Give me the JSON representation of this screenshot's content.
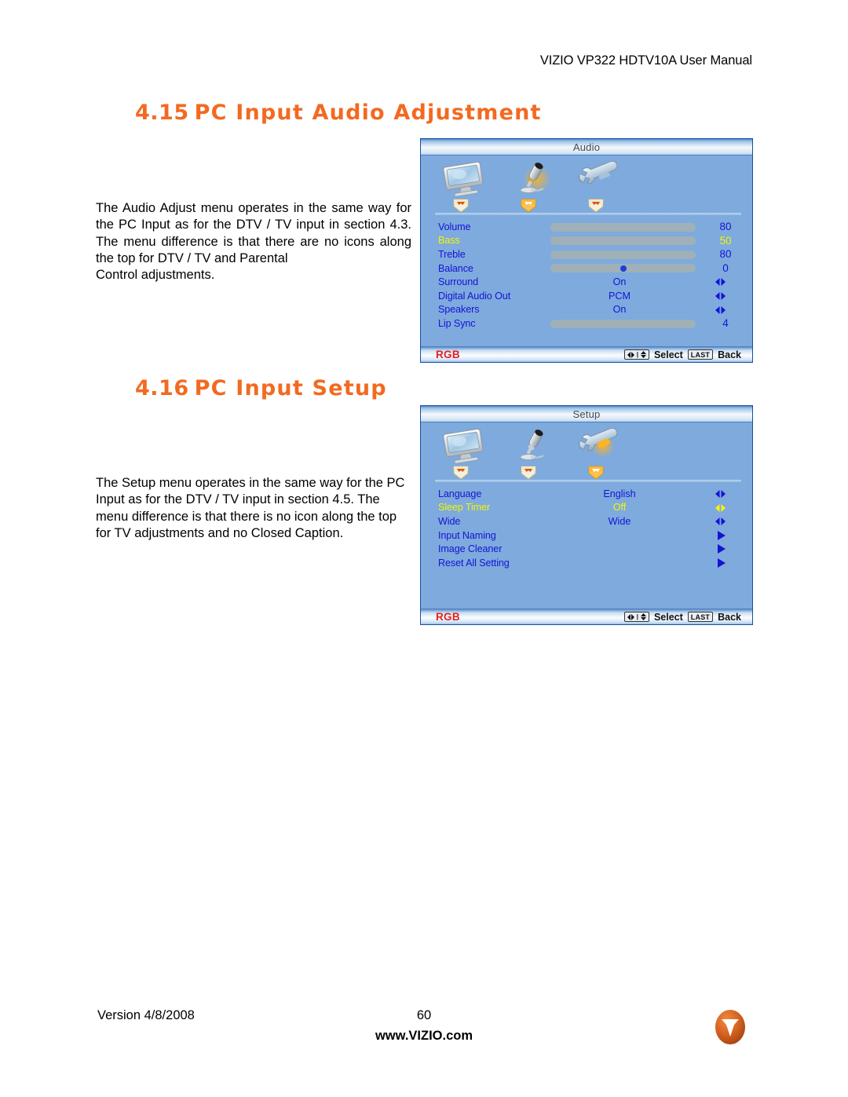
{
  "page_header": "VIZIO VP322 HDTV10A User Manual",
  "sections": [
    {
      "number": "4.15",
      "title": "PC Input Audio Adjustment",
      "paragraph_lines": [
        "The Audio Adjust menu operates in the same way for the PC Input as for the DTV / TV input in section 4.3.  The menu difference is that there are no icons along the top for DTV / TV and Parental",
        "Control adjustments."
      ]
    },
    {
      "number": "4.16",
      "title": "PC Input Setup",
      "paragraph_lines": [
        "The Setup menu operates in the same way for the PC Input as for the DTV / TV input in section 4.5. The menu difference is that there is no icon along the top for TV adjustments and no Closed Caption."
      ]
    }
  ],
  "osd_audio": {
    "title": "Audio",
    "icons": [
      {
        "name": "tv-picture-icon",
        "label": "Picture",
        "selected": false
      },
      {
        "name": "microphone-audio-icon",
        "label": "Audio",
        "selected": true
      },
      {
        "name": "wrench-setup-icon",
        "label": "Setup",
        "selected": false
      }
    ],
    "rows": [
      {
        "label": "Volume",
        "type": "slider",
        "value": "80",
        "fill": 84,
        "selected": false
      },
      {
        "label": "Bass",
        "type": "slider",
        "value": "50",
        "fill": 50,
        "selected": true
      },
      {
        "label": "Treble",
        "type": "slider",
        "value": "80",
        "fill": 84,
        "selected": false
      },
      {
        "label": "Balance",
        "type": "knob",
        "value": "0",
        "fill": 50,
        "selected": false
      },
      {
        "label": "Surround",
        "type": "option",
        "value": "On",
        "selected": false
      },
      {
        "label": "Digital Audio Out",
        "type": "option",
        "value": "PCM",
        "selected": false
      },
      {
        "label": "Speakers",
        "type": "option",
        "value": "On",
        "selected": false
      },
      {
        "label": "Lip Sync",
        "type": "slider",
        "value": "4",
        "fill": 84,
        "selected": false
      }
    ],
    "status": {
      "source": "RGB",
      "select_label": "Select",
      "last_key": "LAST",
      "back_label": "Back"
    },
    "colors": {
      "panel_bg": "#7eaade",
      "label": "#1414d2",
      "selected": "#f5f500",
      "bar_fill": "#1414e6",
      "bar_track": "#9fb0b8",
      "source": "#e32020"
    }
  },
  "osd_setup": {
    "title": "Setup",
    "icons": [
      {
        "name": "tv-picture-icon",
        "label": "Picture",
        "selected": false
      },
      {
        "name": "microphone-audio-icon",
        "label": "Audio",
        "selected": false
      },
      {
        "name": "wrench-setup-icon",
        "label": "Setup",
        "selected": true
      }
    ],
    "rows": [
      {
        "label": "Language",
        "type": "option",
        "value": "English",
        "selected": false
      },
      {
        "label": "Sleep Timer",
        "type": "option",
        "value": "Off",
        "selected": true
      },
      {
        "label": "Wide",
        "type": "option",
        "value": "Wide",
        "selected": false
      },
      {
        "label": "Input Naming",
        "type": "submenu",
        "value": "",
        "selected": false
      },
      {
        "label": "Image Cleaner",
        "type": "submenu",
        "value": "",
        "selected": false
      },
      {
        "label": "Reset All Setting",
        "type": "submenu",
        "value": "",
        "selected": false
      }
    ],
    "status": {
      "source": "RGB",
      "select_label": "Select",
      "last_key": "LAST",
      "back_label": "Back"
    }
  },
  "footer": {
    "version": "Version 4/8/2008",
    "page_number": "60",
    "website": "www.VIZIO.com",
    "logo_letter": "V",
    "logo_color": "#D4601F"
  }
}
